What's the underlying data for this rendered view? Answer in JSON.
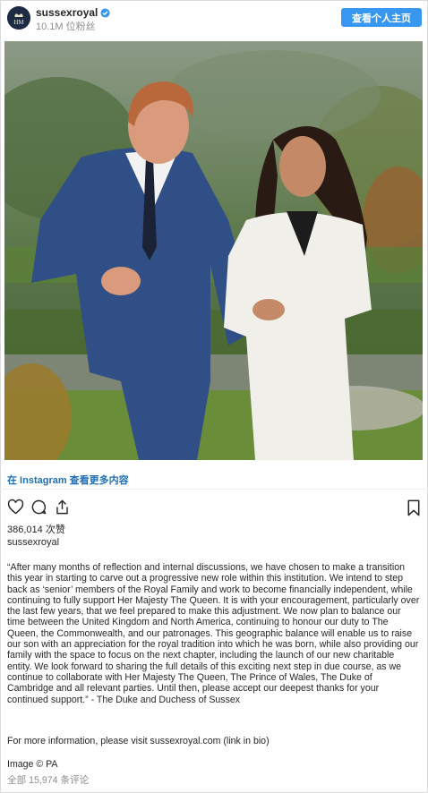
{
  "header": {
    "username": "sussexroyal",
    "followers": "10.1M 位粉丝",
    "profile_button": "查看个人主页"
  },
  "post": {
    "instagram_link": "在 Instagram 查看更多内容",
    "likes": "386,014 次赞",
    "author": "sussexroyal",
    "caption": "“After many months of reflection and internal discussions, we have chosen to make a transition this year in starting to carve out a progressive new role within this institution. We intend to step back as ‘senior’ members of the Royal Family and work to become financially independent, while continuing to fully support Her Majesty The Queen. It is with your encouragement, particularly over the last few years, that we feel prepared to make this adjustment. We now plan to balance our time between the United Kingdom and North America, continuing to honour our duty to The Queen, the Commonwealth, and our patronages. This geographic balance will enable us to raise our son with an appreciation for the royal tradition into which he was born, while also providing our family with the space to focus on the next chapter, including the launch of our new charitable entity. We look forward to sharing the full details of this exciting next step in due course, as we continue to collaborate with Her Majesty The Queen, The Prince of Wales, The Duke of Cambridge and all relevant parties. Until then, please accept our deepest thanks for your continued support.” - The Duke and Duchess of Sussex",
    "more_info": "For more information, please visit sussexroyal.com (link in bio)",
    "credit": "Image © PA",
    "comments": "全部 15,974 条评论"
  },
  "icons": {
    "avatar": "royal-monogram-icon",
    "verified": "verified-badge-icon",
    "like": "heart-icon",
    "comment": "comment-bubble-icon",
    "share": "share-icon",
    "save": "bookmark-icon"
  },
  "colors": {
    "accent": "#3897f0",
    "link": "#1f6fb5",
    "muted": "#8e8e8e",
    "text": "#262626"
  }
}
